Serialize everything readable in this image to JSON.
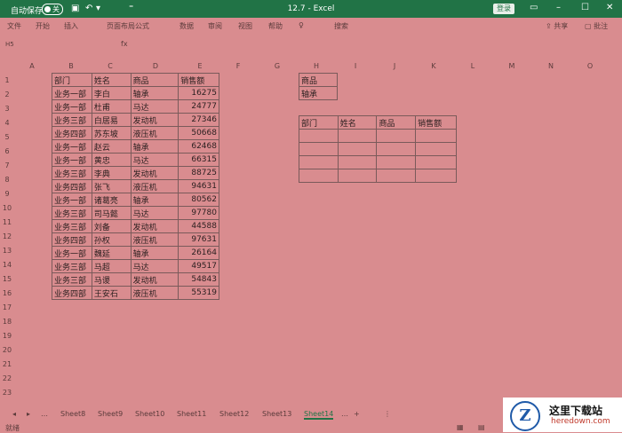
{
  "titlebar": {
    "autosave_label": "自动保存",
    "toggle_label": "关",
    "doc_title": "12.7 - Excel",
    "login_label": "登录"
  },
  "ribbon": {
    "tabs": [
      "文件",
      "开始",
      "插入",
      "页面布局",
      "公式",
      "数据",
      "审阅",
      "视图",
      "帮助",
      "♀",
      "搜索"
    ],
    "share": "共享",
    "comments": "批注"
  },
  "formula_bar": {
    "name_box": "H5",
    "fx": "fx"
  },
  "columns": [
    "A",
    "B",
    "C",
    "D",
    "E",
    "F",
    "G",
    "H",
    "I",
    "J",
    "K",
    "L",
    "M",
    "N",
    "O"
  ],
  "rows": [
    "1",
    "2",
    "3",
    "4",
    "5",
    "6",
    "7",
    "8",
    "9",
    "10",
    "11",
    "12",
    "13",
    "14",
    "15",
    "16",
    "17",
    "18",
    "19",
    "20",
    "21",
    "22",
    "23"
  ],
  "main_table": {
    "headers": [
      "部门",
      "姓名",
      "商品",
      "销售额"
    ],
    "rows": [
      [
        "业务一部",
        "李白",
        "轴承",
        "16275"
      ],
      [
        "业务一部",
        "杜甫",
        "马达",
        "24777"
      ],
      [
        "业务三部",
        "白居易",
        "发动机",
        "27346"
      ],
      [
        "业务四部",
        "苏东坡",
        "液压机",
        "50668"
      ],
      [
        "业务一部",
        "赵云",
        "轴承",
        "62468"
      ],
      [
        "业务一部",
        "黄忠",
        "马达",
        "66315"
      ],
      [
        "业务三部",
        "李典",
        "发动机",
        "88725"
      ],
      [
        "业务四部",
        "张飞",
        "液压机",
        "94631"
      ],
      [
        "业务一部",
        "诸葛亮",
        "轴承",
        "80562"
      ],
      [
        "业务三部",
        "司马懿",
        "马达",
        "97780"
      ],
      [
        "业务三部",
        "刘备",
        "发动机",
        "44588"
      ],
      [
        "业务四部",
        "孙权",
        "液压机",
        "97631"
      ],
      [
        "业务一部",
        "魏延",
        "轴承",
        "26164"
      ],
      [
        "业务三部",
        "马超",
        "马达",
        "49517"
      ],
      [
        "业务三部",
        "马谡",
        "发动机",
        "54843"
      ],
      [
        "业务四部",
        "王安石",
        "液压机",
        "55319"
      ]
    ]
  },
  "criteria": {
    "label": "商品",
    "value": "轴承"
  },
  "result_table": {
    "headers": [
      "部门",
      "姓名",
      "商品",
      "销售额"
    ]
  },
  "sheet_tabs": [
    "Sheet8",
    "Sheet9",
    "Sheet10",
    "Sheet11",
    "Sheet12",
    "Sheet13",
    "Sheet14"
  ],
  "active_sheet": "Sheet14",
  "status": {
    "ready": "就绪"
  },
  "watermark": {
    "logo": "Z",
    "title": "这里下载站",
    "url": "heredown.com"
  }
}
